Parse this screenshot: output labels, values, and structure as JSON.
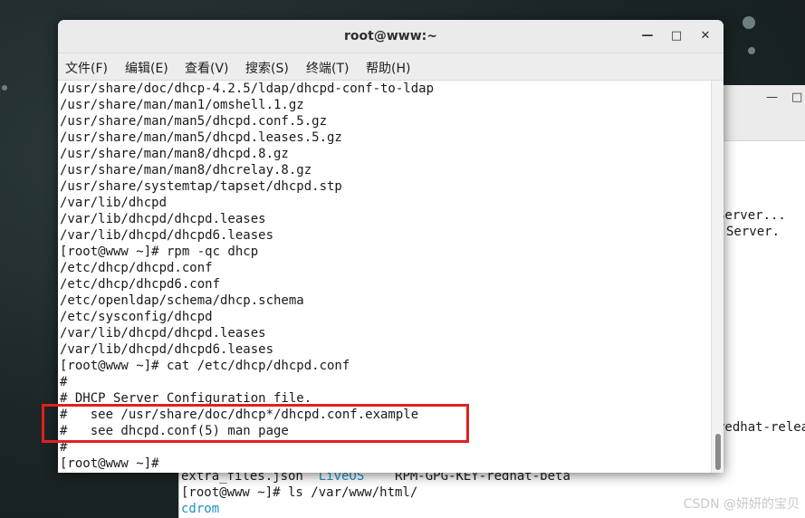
{
  "desktop": {
    "watermark": "CSDN @妍妍的宝贝"
  },
  "background_window": {
    "controls": {
      "minimize": "—",
      "maximize": "□"
    },
    "right_fragments": [
      "Server...",
      "Server.",
      "redhat-relea"
    ],
    "bottom_lines": [
      {
        "parts": [
          "extra_files.json  ",
          "LiveOS",
          "    RPM-GPG-KEY-redhat-beta"
        ]
      },
      {
        "text": "[root@www ~]# ls /var/www/html/"
      },
      {
        "text": "cdrom"
      }
    ]
  },
  "window": {
    "title": "root@www:~",
    "controls": {
      "minimize": "—",
      "maximize": "□",
      "close": "✕"
    }
  },
  "menu": [
    {
      "label": "文件(F)"
    },
    {
      "label": "编辑(E)"
    },
    {
      "label": "查看(V)"
    },
    {
      "label": "搜索(S)"
    },
    {
      "label": "终端(T)"
    },
    {
      "label": "帮助(H)"
    }
  ],
  "terminal": {
    "lines": [
      "/usr/share/doc/dhcp-4.2.5/ldap/dhcpd-conf-to-ldap",
      "/usr/share/man/man1/omshell.1.gz",
      "/usr/share/man/man5/dhcpd.conf.5.gz",
      "/usr/share/man/man5/dhcpd.leases.5.gz",
      "/usr/share/man/man8/dhcpd.8.gz",
      "/usr/share/man/man8/dhcrelay.8.gz",
      "/usr/share/systemtap/tapset/dhcpd.stp",
      "/var/lib/dhcpd",
      "/var/lib/dhcpd/dhcpd.leases",
      "/var/lib/dhcpd/dhcpd6.leases",
      "[root@www ~]# rpm -qc dhcp",
      "/etc/dhcp/dhcpd.conf",
      "/etc/dhcp/dhcpd6.conf",
      "/etc/openldap/schema/dhcp.schema",
      "/etc/sysconfig/dhcpd",
      "/var/lib/dhcpd/dhcpd.leases",
      "/var/lib/dhcpd/dhcpd6.leases",
      "[root@www ~]# cat /etc/dhcp/dhcpd.conf",
      "#",
      "# DHCP Server Configuration file.",
      "#   see /usr/share/doc/dhcp*/dhcpd.conf.example",
      "#   see dhcpd.conf(5) man page",
      "#",
      "[root@www ~]#"
    ]
  },
  "colors": {
    "highlight": "#e02020",
    "liveos": "#1e90c8",
    "cdrom": "#1e90c8"
  }
}
